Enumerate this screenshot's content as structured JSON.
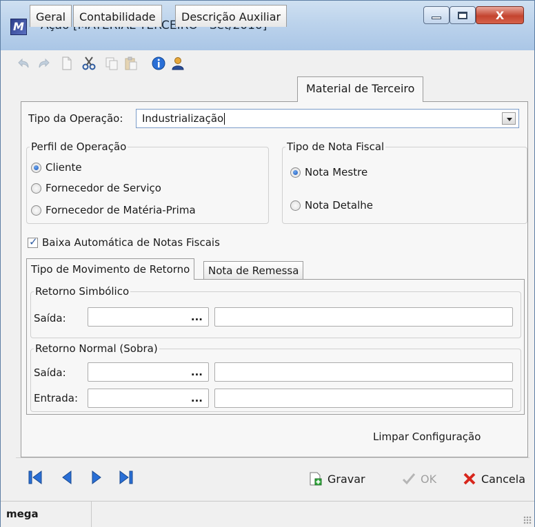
{
  "window": {
    "title": "Ação [MATERIAL TERCEIRO - Set/2010]",
    "close_label": "X"
  },
  "toolbar": {
    "icons": [
      "undo-icon",
      "redo-icon",
      "new-document-icon",
      "cut-icon",
      "copy-icon",
      "paste-icon",
      "info-icon",
      "user-icon"
    ]
  },
  "tabs": [
    {
      "label": "Geral"
    },
    {
      "label": "Contabilidade"
    },
    {
      "label": "Descrição Auxiliar"
    },
    {
      "label": "Material de Terceiro"
    }
  ],
  "operation": {
    "label": "Tipo da Operação:",
    "value": "Industrialização"
  },
  "perfil": {
    "title": "Perfil de Operação",
    "options": [
      {
        "label": "Cliente",
        "checked": true
      },
      {
        "label": "Fornecedor de Serviço",
        "checked": false
      },
      {
        "label": "Fornecedor de Matéria-Prima",
        "checked": false
      }
    ]
  },
  "nota_fiscal": {
    "title": "Tipo de Nota Fiscal",
    "options": [
      {
        "label": "Nota Mestre",
        "checked": true
      },
      {
        "label": "Nota Detalhe",
        "checked": false
      }
    ]
  },
  "baixa": {
    "label": "Baixa Automática de Notas Fiscais",
    "checked": true
  },
  "inner_tabs": [
    {
      "label": "Tipo de Movimento de Retorno"
    },
    {
      "label": "Nota de Remessa"
    }
  ],
  "retorno_simbolico": {
    "title": "Retorno Simbólico",
    "saida_label": "Saída:",
    "ellipsis": "..."
  },
  "retorno_normal": {
    "title": "Retorno Normal (Sobra)",
    "saida_label": "Saída:",
    "entrada_label": "Entrada:",
    "ellipsis": "..."
  },
  "limpar": "Limpar Configuração",
  "buttons": {
    "gravar": "Gravar",
    "ok": "OK",
    "cancela": "Cancela"
  },
  "status": {
    "user": "mega"
  },
  "colors": {
    "accent": "#1a56b8",
    "titlebar": "#bcd3ec",
    "close_button": "#c4442f"
  }
}
